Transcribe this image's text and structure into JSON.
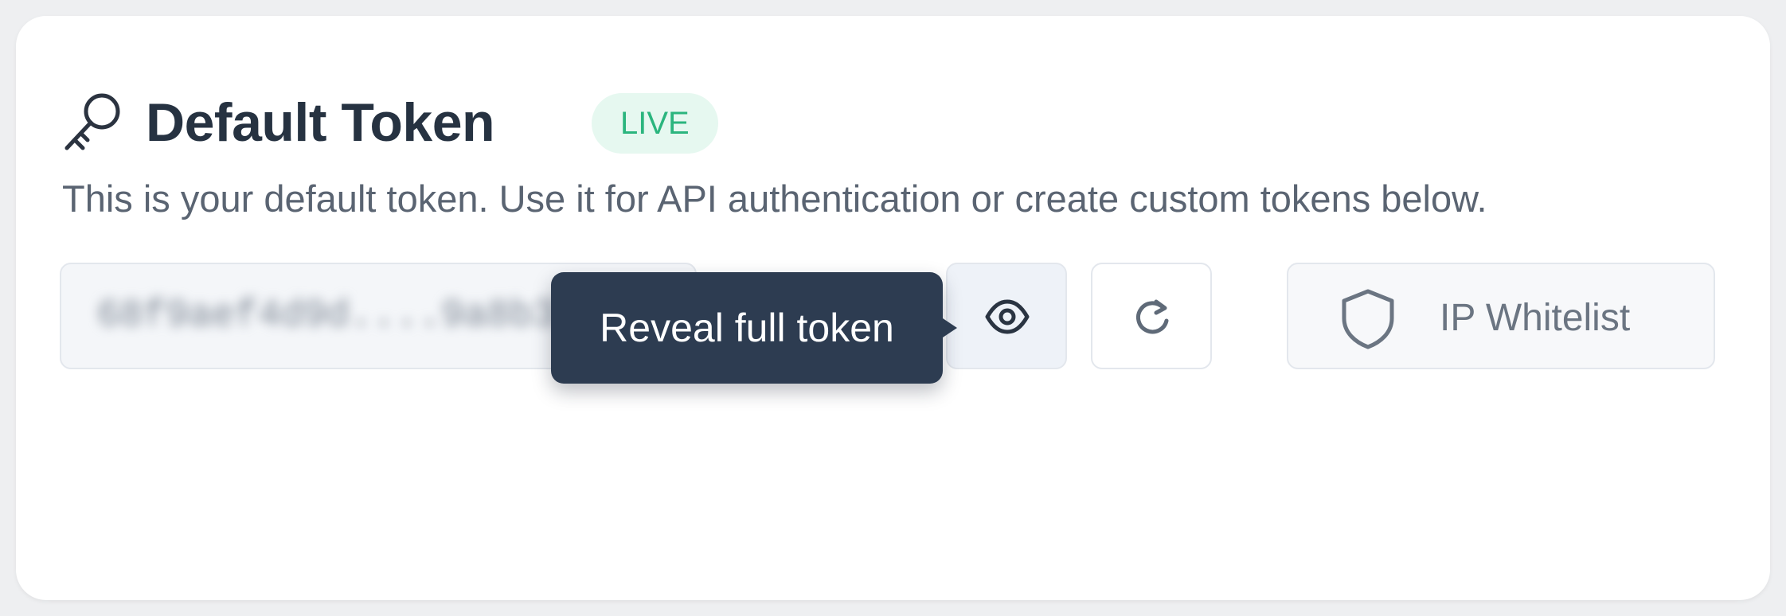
{
  "header": {
    "icon": "key-icon",
    "title": "Default Token",
    "badge": "LIVE"
  },
  "description": "This is your default token. Use it for API authentication or create custom tokens below.",
  "token": {
    "masked_value": "68f9aef4d9d....9a8b3",
    "blurred": true
  },
  "actions": {
    "reveal_icon": "eye-icon",
    "refresh_icon": "refresh-icon",
    "ip_icon": "shield-icon",
    "ip_whitelist_label": "IP Whitelist"
  },
  "tooltip": {
    "text": "Reveal full token"
  },
  "colors": {
    "title": "#263241",
    "badge_text": "#2bb57e",
    "badge_bg": "#e6f8f0",
    "tooltip_bg": "#2d3c51",
    "border": "#e3e7ed"
  }
}
